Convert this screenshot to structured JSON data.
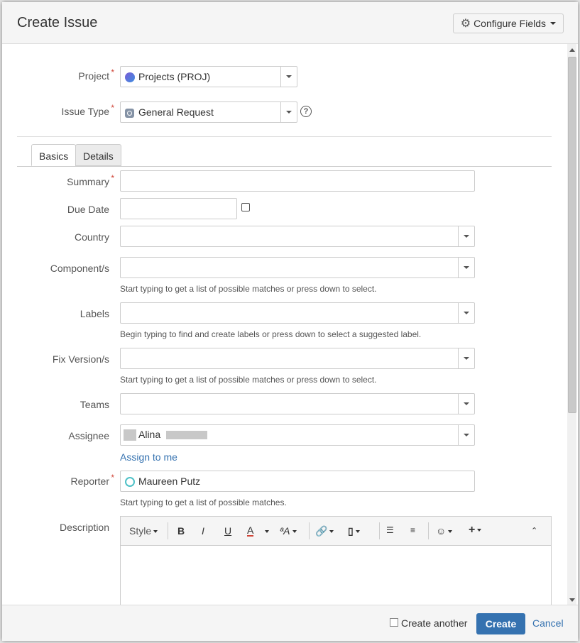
{
  "dialog": {
    "title": "Create Issue",
    "configure_fields": "Configure Fields"
  },
  "fields": {
    "project": {
      "label": "Project",
      "value": "Projects (PROJ)"
    },
    "issue_type": {
      "label": "Issue Type",
      "value": "General Request"
    },
    "summary": {
      "label": "Summary",
      "value": ""
    },
    "due_date": {
      "label": "Due Date",
      "value": ""
    },
    "country": {
      "label": "Country",
      "value": ""
    },
    "components": {
      "label": "Component/s",
      "value": "",
      "hint": "Start typing to get a list of possible matches or press down to select."
    },
    "labels": {
      "label": "Labels",
      "value": "",
      "hint": "Begin typing to find and create labels or press down to select a suggested label."
    },
    "fix_versions": {
      "label": "Fix Version/s",
      "value": "",
      "hint": "Start typing to get a list of possible matches or press down to select."
    },
    "teams": {
      "label": "Teams",
      "value": ""
    },
    "assignee": {
      "label": "Assignee",
      "value": "Alina",
      "assign_to_me": "Assign to me"
    },
    "reporter": {
      "label": "Reporter",
      "value": "Maureen Putz",
      "hint": "Start typing to get a list of possible matches."
    },
    "description": {
      "label": "Description"
    }
  },
  "tabs": [
    {
      "label": "Basics",
      "active": true
    },
    {
      "label": "Details",
      "active": false
    }
  ],
  "editor_toolbar": {
    "style": "Style",
    "bold": "B",
    "italic": "I",
    "underline": "U",
    "text_color": "A",
    "text_effects": "ªA"
  },
  "footer": {
    "create_another": "Create another",
    "create": "Create",
    "cancel": "Cancel"
  },
  "colors": {
    "primary": "#3572b0",
    "required": "#d04437"
  }
}
